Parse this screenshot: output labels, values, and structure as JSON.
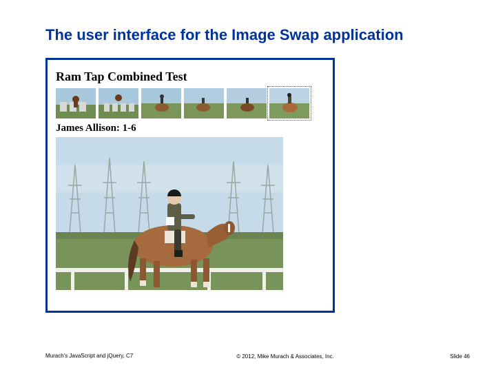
{
  "title": "The user interface for the Image Swap application",
  "app": {
    "heading": "Ram Tap Combined Test",
    "caption": "James Allison: 1-6"
  },
  "footer": {
    "left": "Murach's JavaScript and jQuery, C7",
    "center": "© 2012, Mike Murach & Associates, Inc.",
    "right": "Slide 46"
  }
}
